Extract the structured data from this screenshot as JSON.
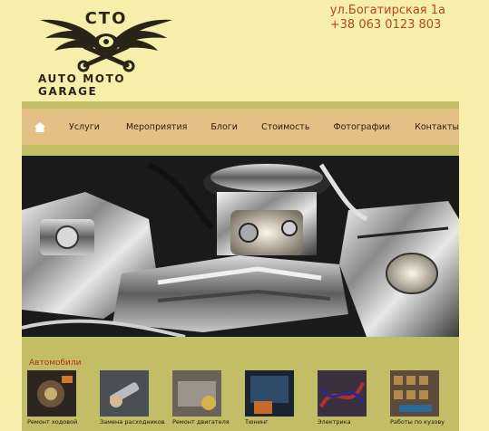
{
  "header": {
    "logo_top": "СТО",
    "logo_bottom": "AUTO MOTO GARAGE",
    "address": "ул.Богатирская 1а",
    "phone": "+38 063 0123 803"
  },
  "nav": {
    "home_icon": "home-icon",
    "items": [
      "Услуги",
      "Мероприятия",
      "Блоги",
      "Стоимость",
      "Фотографии",
      "Контакты"
    ]
  },
  "hero": {
    "image": "chrome-engine-photo"
  },
  "section": {
    "title": "Автомобили",
    "items": [
      "Ремонт ходовой",
      "Замена расходников",
      "Ремонт двигателя",
      "Тюнинг",
      "Электрика",
      "Работы по кузову"
    ]
  },
  "colors": {
    "page_bg": "#f6eeaa",
    "panel_bg": "#c2bd66",
    "nav_bg": "#e4bf86",
    "accent": "#b34a1e",
    "section_title": "#b0301a"
  }
}
